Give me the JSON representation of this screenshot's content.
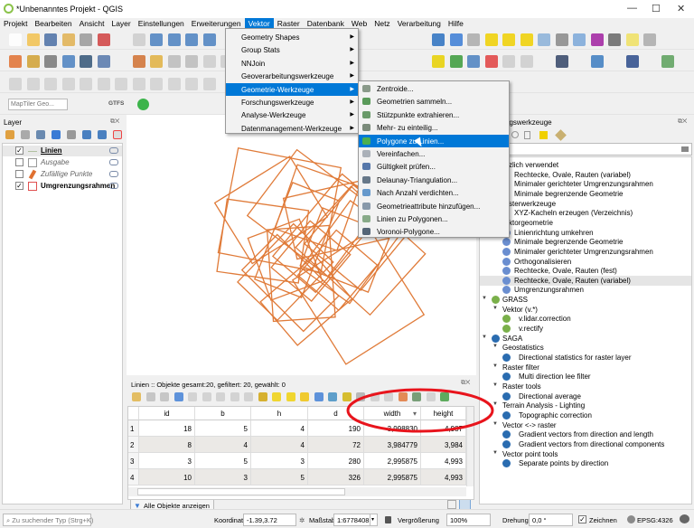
{
  "window": {
    "title": "*Unbenanntes Projekt - QGIS",
    "minimize": "—",
    "maximize": "☐",
    "close": "✕"
  },
  "menubar": [
    "Projekt",
    "Bearbeiten",
    "Ansicht",
    "Layer",
    "Einstellungen",
    "Erweiterungen",
    "Vektor",
    "Raster",
    "Datenbank",
    "Web",
    "Netz",
    "Verarbeitung",
    "Hilfe"
  ],
  "menubar_active": "Vektor",
  "vektor_menu": [
    {
      "label": "Geometry Shapes"
    },
    {
      "label": "Group Stats"
    },
    {
      "label": "NNJoin"
    },
    {
      "label": "Geoverarbeitungswerkzeuge"
    },
    {
      "label": "Geometrie-Werkzeuge",
      "active": true
    },
    {
      "label": "Forschungswerkzeuge"
    },
    {
      "label": "Analyse-Werkzeuge"
    },
    {
      "label": "Datenmanagement-Werkzeuge"
    }
  ],
  "geometrie_submenu": [
    {
      "label": "Zentroide...",
      "icon": "centroid-icon",
      "color": "#8a9a8a"
    },
    {
      "label": "Geometrien sammeln...",
      "icon": "collect-geometries-icon",
      "color": "#5a9a5a"
    },
    {
      "label": "Stützpunkte extrahieren...",
      "icon": "extract-vertices-icon",
      "color": "#6a9a6a"
    },
    {
      "label": "Mehr- zu einteilig...",
      "icon": "multipart-icon",
      "color": "#7a8a7a"
    },
    {
      "label": "Polygone zu Linien...",
      "icon": "polygon-to-lines-icon",
      "color": "#4caf50",
      "active": true
    },
    {
      "label": "Vereinfachen...",
      "icon": "simplify-icon",
      "color": "#aab0b8"
    },
    {
      "label": "Gültigkeit prüfen...",
      "icon": "check-validity-icon",
      "color": "#5577aa"
    },
    {
      "label": "Delaunay-Triangulation...",
      "icon": "delaunay-icon",
      "color": "#667788"
    },
    {
      "label": "Nach Anzahl verdichten...",
      "icon": "densify-icon",
      "color": "#6699cc"
    },
    {
      "label": "Geometrieattribute hinzufügen...",
      "icon": "add-geometry-attributes-icon",
      "color": "#8899aa"
    },
    {
      "label": "Linien zu Polygonen...",
      "icon": "lines-to-polygons-icon",
      "color": "#88aa88"
    },
    {
      "label": "Voronoi-Polygone...",
      "icon": "voronoi-icon",
      "color": "#556677"
    }
  ],
  "locator_toolbar": {
    "search_placeholder": "MapTiler Geo...",
    "gtfs_label": "GTFS"
  },
  "layers_panel": {
    "title": "Layer",
    "layers": [
      {
        "name": "Linien",
        "checked": true,
        "style": "bold-underline",
        "symbol": "line",
        "color": "#b0c0a0"
      },
      {
        "name": "Ausgabe",
        "checked": false,
        "style": "italic",
        "symbol": "polygon",
        "color": "#999999"
      },
      {
        "name": "Zufällige Punkte",
        "checked": false,
        "style": "italic",
        "symbol": "point",
        "color": "#e07030"
      },
      {
        "name": "Umgrenzungsrahmen",
        "checked": true,
        "style": "bold",
        "symbol": "polygon",
        "color": "#e05050"
      }
    ]
  },
  "map": {
    "feature_color": "#e07b39"
  },
  "attribute_table": {
    "title": "Linien :: Objekte gesamt:20, gefiltert: 20, gewählt: 0",
    "columns": [
      "id",
      "b",
      "h",
      "d",
      "width",
      "height"
    ],
    "sort_indicator": "▾",
    "rows": [
      {
        "n": "1",
        "cells": [
          "18",
          "5",
          "4",
          "190",
          "3,998830",
          "4,987"
        ]
      },
      {
        "n": "2",
        "cells": [
          "8",
          "4",
          "4",
          "72",
          "3,984779",
          "3,984"
        ]
      },
      {
        "n": "3",
        "cells": [
          "3",
          "5",
          "3",
          "280",
          "2,995875",
          "4,993"
        ]
      },
      {
        "n": "4",
        "cells": [
          "10",
          "3",
          "5",
          "326",
          "2,995875",
          "4,993"
        ]
      }
    ],
    "filter_button": "Alle Objekte anzeigen"
  },
  "processing": {
    "title": "ngswerkzeuge",
    "tree": [
      {
        "label": "zlich verwendet",
        "level": 0,
        "x": 34,
        "type": "group"
      },
      {
        "label": "Rechtecke, Ovale, Rauten (variabel)",
        "level": 2,
        "x": 40
      },
      {
        "label": "Minimaler gerichteter Umgrenzungsrahmen",
        "level": 2,
        "x": 40
      },
      {
        "label": "Minimale begrenzende Geometrie",
        "level": 2,
        "x": 40
      },
      {
        "label": "sterwerkzeuge",
        "level": 0,
        "x": 34,
        "type": "group"
      },
      {
        "label": "XYZ-Kacheln erzeugen (Verzeichnis)",
        "level": 2,
        "x": 40
      },
      {
        "label": "ktorgeometrie",
        "level": 0,
        "x": 34,
        "type": "group"
      },
      {
        "label": "Linienrichtung umkehren",
        "level": 2,
        "x": 40,
        "icon": "qgis"
      },
      {
        "label": "Minimale begrenzende Geometrie",
        "level": 2,
        "x": 40,
        "icon": "qgis"
      },
      {
        "label": "Minimaler gerichteter Umgrenzungsrahmen",
        "level": 2,
        "x": 40,
        "icon": "qgis"
      },
      {
        "label": "Orthogonalisieren",
        "level": 2,
        "x": 40,
        "icon": "qgis"
      },
      {
        "label": "Rechtecke, Ovale, Rauten (fest)",
        "level": 2,
        "x": 40,
        "icon": "qgis"
      },
      {
        "label": "Rechtecke, Ovale, Rauten (variabel)",
        "level": 2,
        "x": 40,
        "icon": "qgis",
        "selected": true
      },
      {
        "label": "Umgrenzungsrahmen",
        "level": 2,
        "x": 40,
        "icon": "qgis"
      },
      {
        "label": "GRASS",
        "level": 0,
        "x": 27,
        "type": "provider",
        "icon": "grass",
        "tri": true
      },
      {
        "label": "Vektor (v.*)",
        "level": 1,
        "x": 27,
        "type": "group",
        "tri": true
      },
      {
        "label": "v.lidar.correction",
        "level": 2,
        "x": 40,
        "icon": "grass"
      },
      {
        "label": "v.rectify",
        "level": 2,
        "x": 40,
        "icon": "grass"
      },
      {
        "label": "SAGA",
        "level": 0,
        "x": 27,
        "type": "provider",
        "icon": "saga",
        "tri": true
      },
      {
        "label": "Geostatistics",
        "level": 1,
        "x": 27,
        "type": "group",
        "tri": true
      },
      {
        "label": "Directional statistics for raster layer",
        "level": 2,
        "x": 40,
        "icon": "saga"
      },
      {
        "label": "Raster filter",
        "level": 1,
        "x": 27,
        "type": "group",
        "tri": true
      },
      {
        "label": "Multi direction lee filter",
        "level": 2,
        "x": 40,
        "icon": "saga"
      },
      {
        "label": "Raster tools",
        "level": 1,
        "x": 27,
        "type": "group",
        "tri": true
      },
      {
        "label": "Directional average",
        "level": 2,
        "x": 40,
        "icon": "saga"
      },
      {
        "label": "Terrain Analysis - Lighting",
        "level": 1,
        "x": 27,
        "type": "group",
        "tri": true
      },
      {
        "label": "Topographic correction",
        "level": 2,
        "x": 40,
        "icon": "saga"
      },
      {
        "label": "Vector <-> raster",
        "level": 1,
        "x": 27,
        "type": "group",
        "tri": true
      },
      {
        "label": "Gradient vectors from direction and length",
        "level": 2,
        "x": 40,
        "icon": "saga"
      },
      {
        "label": "Gradient vectors from directional components",
        "level": 2,
        "x": 40,
        "icon": "saga"
      },
      {
        "label": "Vector point tools",
        "level": 1,
        "x": 27,
        "type": "group",
        "tri": true
      },
      {
        "label": "Separate points by direction",
        "level": 2,
        "x": 40,
        "icon": "saga"
      }
    ]
  },
  "statusbar": {
    "search_placeholder": "Zu suchender Typ (Strg+K)",
    "coord_label": "Koordinate",
    "coord_value": "-1.39,3.72",
    "scale_label": "Maßstab",
    "scale_value": "1:6778408",
    "magnifier_label": "Vergrößerung",
    "magnifier_value": "100%",
    "rotation_label": "Drehung",
    "rotation_value": "0,0 °",
    "render_label": "Zeichnen",
    "render_checked": true,
    "crs": "EPSG:4326"
  },
  "annotation_color": "#e8141c",
  "accent": "#0078d7"
}
